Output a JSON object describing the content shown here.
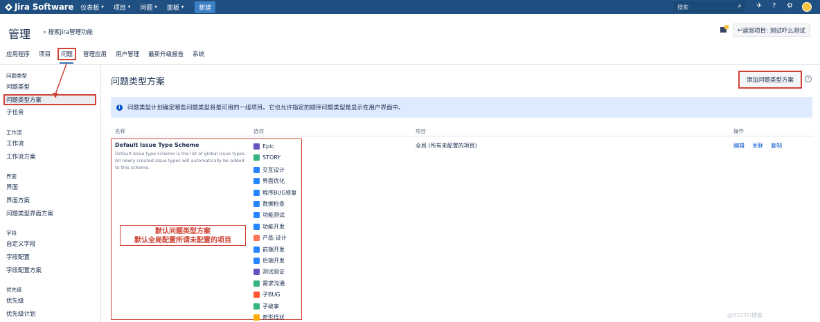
{
  "topbar": {
    "logo": "Jira Software",
    "nav": [
      "仪表板",
      "项目",
      "问题",
      "面板"
    ],
    "create": "新建",
    "search_placeholder": "搜索"
  },
  "header": {
    "title": "管理",
    "admin_search": "搜索Jira管理功能",
    "return_label": "返回项目: 测试吓么测试"
  },
  "tabs": [
    "应用程序",
    "项目",
    "问题",
    "管理应用",
    "用户管理",
    "最新升级报告",
    "系统"
  ],
  "sidebar": {
    "groups": [
      {
        "title": "问题类型",
        "items": [
          "问题类型",
          "问题类型方案",
          "子任务"
        ]
      },
      {
        "title": "工作流",
        "items": [
          "工作流",
          "工作流方案"
        ]
      },
      {
        "title": "界面",
        "items": [
          "界面",
          "界面方案",
          "问题类型界面方案"
        ]
      },
      {
        "title": "字段",
        "items": [
          "自定义字段",
          "字段配置",
          "字段配置方案"
        ]
      },
      {
        "title": "优先级",
        "items": [
          "优先级",
          "优先级计划"
        ]
      }
    ]
  },
  "main": {
    "title": "问题类型方案",
    "add_button": "添加问题类型方案",
    "info": "问题类型计划确定哪些问题类型将是可用的一组项目。它也允许指定的顺序问题类型是显示在用户界面中。",
    "columns": [
      "名称",
      "选项",
      "项目",
      "操作"
    ],
    "scheme": {
      "name": "Default Issue Type Scheme",
      "description": "Default issue type scheme is the list of global issue types. All newly created issue types will automatically be added to this scheme.",
      "project": "全局 (所有未配置的项目)",
      "ops": [
        "编辑",
        "关联",
        "复制"
      ]
    },
    "issue_types": [
      {
        "label": "Epic",
        "color": "#6554c0"
      },
      {
        "label": "STORY",
        "color": "#36b37e"
      },
      {
        "label": "交互设计",
        "color": "#2684ff"
      },
      {
        "label": "界面优化",
        "color": "#2684ff"
      },
      {
        "label": "程序BUG修复",
        "color": "#2684ff"
      },
      {
        "label": "数据检查",
        "color": "#2684ff"
      },
      {
        "label": "功能测试",
        "color": "#2684ff"
      },
      {
        "label": "功能开发",
        "color": "#2684ff"
      },
      {
        "label": "产品 设计",
        "color": "#ff7452"
      },
      {
        "label": "前端开发",
        "color": "#2684ff"
      },
      {
        "label": "后端开发",
        "color": "#2684ff"
      },
      {
        "label": "测试验证",
        "color": "#6554c0"
      },
      {
        "label": "需求沟通",
        "color": "#36b37e"
      },
      {
        "label": "子BUG",
        "color": "#ff5630"
      },
      {
        "label": "子故事",
        "color": "#36b37e"
      },
      {
        "label": "奇形怪状",
        "color": "#ffab00"
      }
    ]
  },
  "annotation": [
    "默认问题类型方案",
    "默认全局配置所谓未配置的项目"
  ],
  "watermark": "@51CTO博客"
}
